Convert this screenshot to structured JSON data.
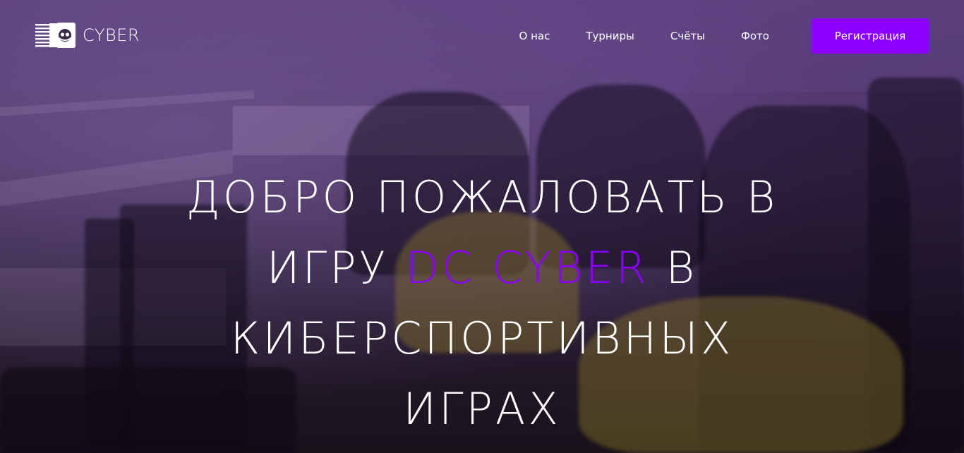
{
  "brand": {
    "logo_text": "CYBER",
    "accent_color": "#8c00ff"
  },
  "nav": {
    "items": [
      {
        "label": "О нас"
      },
      {
        "label": "Турниры"
      },
      {
        "label": "Счёты"
      },
      {
        "label": "Фото"
      }
    ],
    "register_label": "Регистрация"
  },
  "hero": {
    "line1": "ДОБРО ПОЖАЛОВАТЬ В",
    "line2_prefix": "ИГРУ",
    "line2_accent": "DC CYBER",
    "line2_suffix": "В",
    "line3": "КИБЕРСПОРТИВНЫХ",
    "line4": "ИГРАХ"
  }
}
